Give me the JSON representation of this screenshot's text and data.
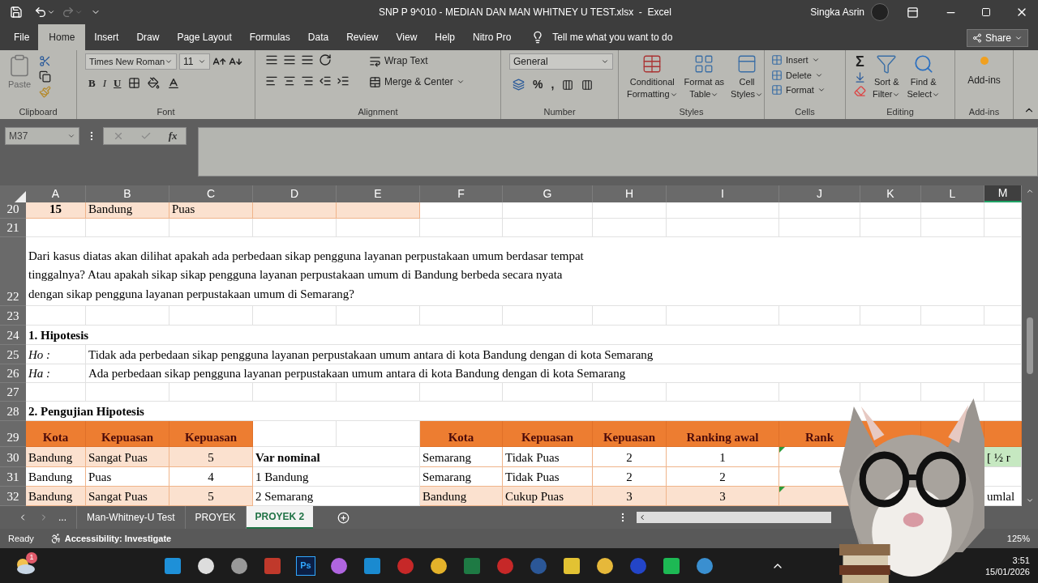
{
  "window": {
    "title": "SNP P 9^010 - MEDIAN DAN MAN WHITNEY U TEST.xlsx  -  Excel",
    "user": "Singka Asrin"
  },
  "ribbon_tabs": [
    {
      "label": "File",
      "selected": false
    },
    {
      "label": "Home",
      "selected": true
    },
    {
      "label": "Insert",
      "selected": false
    },
    {
      "label": "Draw",
      "selected": false
    },
    {
      "label": "Page Layout",
      "selected": false
    },
    {
      "label": "Formulas",
      "selected": false
    },
    {
      "label": "Data",
      "selected": false
    },
    {
      "label": "Review",
      "selected": false
    },
    {
      "label": "View",
      "selected": false
    },
    {
      "label": "Help",
      "selected": false
    },
    {
      "label": "Nitro Pro",
      "selected": false
    }
  ],
  "tell_me": "Tell me what you want to do",
  "share": "Share",
  "ribbon": {
    "paste": "Paste",
    "font_name": "Times New Roman",
    "font_size": "11",
    "font_buttons": [
      "B",
      "I",
      "U"
    ],
    "wrap_text": "Wrap Text",
    "merge": "Merge & Center",
    "number_format": "General",
    "number_buttons": [
      "%",
      ","
    ],
    "styles": [
      {
        "line1": "Conditional",
        "line2": "Formatting"
      },
      {
        "line1": "Format as",
        "line2": "Table"
      },
      {
        "line1": "Cell",
        "line2": "Styles"
      }
    ],
    "cells": [
      "Insert",
      "Delete",
      "Format"
    ],
    "autosum": "Σ",
    "editing": [
      {
        "line1": "Sort &",
        "line2": "Filter"
      },
      {
        "line1": "Find &",
        "line2": "Select"
      }
    ],
    "addins": "Add-ins",
    "groups": [
      "Clipboard",
      "Font",
      "Alignment",
      "Number",
      "Styles",
      "Cells",
      "Editing",
      "Add-ins"
    ]
  },
  "formula_bar": {
    "name_box": "M37",
    "function_label": "fx"
  },
  "columns": [
    {
      "label": "A",
      "selected": false
    },
    {
      "label": "B",
      "selected": false
    },
    {
      "label": "C",
      "selected": false
    },
    {
      "label": "D",
      "selected": false
    },
    {
      "label": "E",
      "selected": false
    },
    {
      "label": "F",
      "selected": false
    },
    {
      "label": "G",
      "selected": false
    },
    {
      "label": "H",
      "selected": false
    },
    {
      "label": "I",
      "selected": false
    },
    {
      "label": "J",
      "selected": false
    },
    {
      "label": "K",
      "selected": false
    },
    {
      "label": "L",
      "selected": false
    },
    {
      "label": "M",
      "selected": true
    }
  ],
  "rows": [
    {
      "number": "20",
      "cells": [
        {
          "kind": "bandcentered",
          "text": "15",
          "bold": true
        },
        {
          "kind": "band",
          "text": "Bandung"
        },
        {
          "kind": "band",
          "text": "Puas"
        },
        {
          "kind": "band"
        },
        {
          "kind": "band"
        }
      ]
    },
    {
      "number": "21"
    },
    {
      "number": "22",
      "cells": [
        {
          "kind": "text",
          "lines": [
            "Dari kasus diatas akan dilihat apakah ada perbedaan sikap pengguna layanan perpustakaan umum berdasar tempat",
            "tinggalnya? Atau apakah sikap sikap pengguna layanan perpustakaan umum di Bandung berbeda secara nyata",
            "dengan sikap pengguna layanan perpustakaan umum di Semarang?"
          ]
        }
      ]
    },
    {
      "number": "23"
    },
    {
      "number": "24",
      "cells": [
        {
          "kind": "text",
          "text": "1. Hipotesis",
          "bold": true
        }
      ]
    },
    {
      "number": "25",
      "cells": [
        {
          "kind": "text",
          "text": "Ho :",
          "italic": true
        },
        {
          "kind": "text",
          "text": "Tidak ada perbedaan sikap pengguna layanan perpustakaan umum antara di kota Bandung dengan di kota Semarang"
        }
      ]
    },
    {
      "number": "26",
      "cells": [
        {
          "kind": "text",
          "text": "Ha :",
          "italic": true
        },
        {
          "kind": "text",
          "text": "Ada perbedaan sikap pengguna layanan perpustakaan umum antara di kota Bandung dengan di kota Semarang"
        }
      ]
    },
    {
      "number": "27"
    },
    {
      "number": "28",
      "cells": [
        {
          "kind": "text",
          "text": "2. Pengujian Hipotesis",
          "bold": true
        }
      ]
    },
    {
      "number": "29",
      "cells": [
        {
          "kind": "header",
          "text": "Kota"
        },
        {
          "kind": "header",
          "text": "Kepuasan"
        },
        {
          "kind": "header",
          "text": "Kepuasan"
        },
        null,
        null,
        {
          "kind": "header",
          "text": "Kota"
        },
        {
          "kind": "header",
          "text": "Kepuasan"
        },
        {
          "kind": "header",
          "text": "Kepuasan"
        },
        {
          "kind": "header",
          "text": "Ranking awal"
        },
        {
          "kind": "header",
          "text": "Rank"
        },
        {
          "kind": "header"
        },
        {
          "kind": "header"
        },
        {
          "kind": "header"
        }
      ]
    },
    {
      "number": "30",
      "cells": [
        {
          "kind": "band",
          "text": "Bandung"
        },
        {
          "kind": "band",
          "text": "Sangat Puas"
        },
        {
          "kind": "bandcentered",
          "text": "5"
        },
        {
          "kind": "text",
          "text": "Var nominal",
          "bold": true
        },
        null,
        {
          "kind": "lined",
          "text": "Semarang"
        },
        {
          "kind": "lined",
          "text": "Tidak Puas"
        },
        {
          "kind": "linedcentered",
          "text": "2"
        },
        {
          "kind": "linedcentered",
          "text": "1"
        },
        {
          "kind": "lined",
          "flag": true
        },
        null,
        null,
        {
          "kind": "green",
          "text": "[ ½ r"
        }
      ]
    },
    {
      "number": "31",
      "cells": [
        {
          "kind": "lined",
          "text": "Bandung"
        },
        {
          "kind": "lined",
          "text": "Puas"
        },
        {
          "kind": "linedcentered",
          "text": "4"
        },
        {
          "kind": "text",
          "text": "1 Bandung"
        },
        null,
        {
          "kind": "lined",
          "text": "Semarang"
        },
        {
          "kind": "lined",
          "text": "Tidak Puas"
        },
        {
          "kind": "linedcentered",
          "text": "2"
        },
        {
          "kind": "linedcentered",
          "text": "2"
        },
        {
          "kind": "lined"
        }
      ]
    },
    {
      "number": "32",
      "cells": [
        {
          "kind": "band",
          "text": "Bandung"
        },
        {
          "kind": "band",
          "text": "Sangat Puas"
        },
        {
          "kind": "bandcentered",
          "text": "5"
        },
        {
          "kind": "text",
          "text": "2 Semarang"
        },
        null,
        {
          "kind": "band",
          "text": "Bandung"
        },
        {
          "kind": "band",
          "text": "Cukup Puas"
        },
        {
          "kind": "bandcentered",
          "text": "3"
        },
        {
          "kind": "bandcentered",
          "text": "3"
        },
        {
          "kind": "band",
          "flag": true
        },
        null,
        null,
        {
          "kind": "text",
          "text": "umlal"
        }
      ]
    }
  ],
  "sheet_tabs": [
    {
      "label": "...",
      "selected": false
    },
    {
      "label": "Man-Whitney-U Test",
      "selected": false
    },
    {
      "label": "PROYEK",
      "selected": false
    },
    {
      "label": "PROYEK 2",
      "selected": true
    }
  ],
  "status_bar": {
    "mode": "Ready",
    "accessibility": "Accessibility: Investigate",
    "zoom": "125%"
  },
  "taskbar": {
    "weather_badge": "1",
    "photoshop": "Ps",
    "time": "3:51",
    "date": "15/01/2026"
  }
}
